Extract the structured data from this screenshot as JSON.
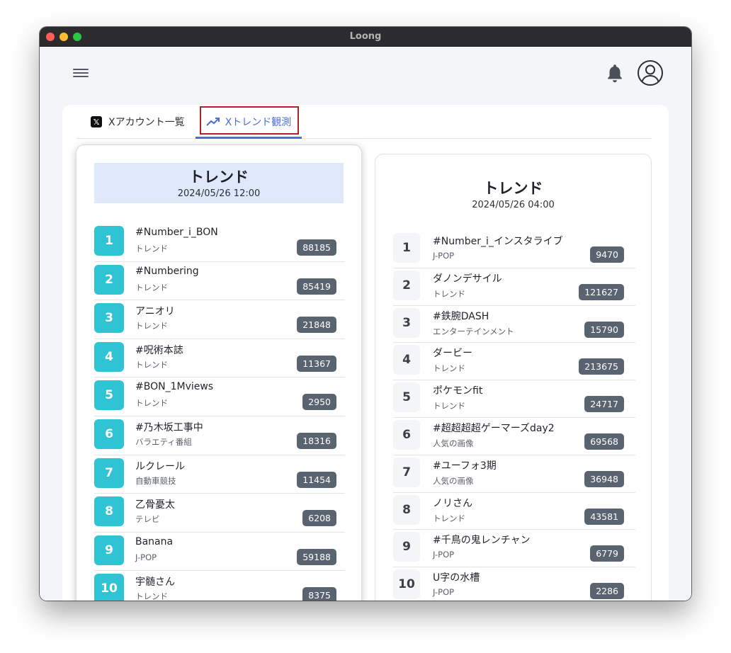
{
  "window": {
    "title": "Loong"
  },
  "tabs": [
    {
      "label": "Xアカウント一覧"
    },
    {
      "label": "Xトレンド観測"
    }
  ],
  "left": {
    "title": "トレンド",
    "datetime": "2024/05/26 12:00",
    "items": [
      {
        "rank": "1",
        "name": "#Number_i_BON",
        "category": "トレンド",
        "count": "88185"
      },
      {
        "rank": "2",
        "name": "#Numbering",
        "category": "トレンド",
        "count": "85419"
      },
      {
        "rank": "3",
        "name": "アニオリ",
        "category": "トレンド",
        "count": "21848"
      },
      {
        "rank": "4",
        "name": "#呪術本誌",
        "category": "トレンド",
        "count": "11367"
      },
      {
        "rank": "5",
        "name": "#BON_1Mviews",
        "category": "トレンド",
        "count": "2950"
      },
      {
        "rank": "6",
        "name": "#乃木坂工事中",
        "category": "バラエティ番組",
        "count": "18316"
      },
      {
        "rank": "7",
        "name": "ルクレール",
        "category": "自動車競技",
        "count": "11454"
      },
      {
        "rank": "8",
        "name": "乙骨憂太",
        "category": "テレビ",
        "count": "6208"
      },
      {
        "rank": "9",
        "name": "Banana",
        "category": "J-POP",
        "count": "59188"
      },
      {
        "rank": "10",
        "name": "宇髄さん",
        "category": "トレンド",
        "count": "8375"
      }
    ]
  },
  "right": {
    "title": "トレンド",
    "datetime": "2024/05/26 04:00",
    "items": [
      {
        "rank": "1",
        "name": "#Number_i_インスタライブ",
        "category": "J-POP",
        "count": "9470"
      },
      {
        "rank": "2",
        "name": "ダノンデサイル",
        "category": "トレンド",
        "count": "121627"
      },
      {
        "rank": "3",
        "name": "#鉄腕DASH",
        "category": "エンターテインメント",
        "count": "15790"
      },
      {
        "rank": "4",
        "name": "ダービー",
        "category": "トレンド",
        "count": "213675"
      },
      {
        "rank": "5",
        "name": "ポケモンfit",
        "category": "トレンド",
        "count": "24717"
      },
      {
        "rank": "6",
        "name": "#超超超超ゲーマーズday2",
        "category": "人気の画像",
        "count": "69568"
      },
      {
        "rank": "7",
        "name": "#ユーフォ3期",
        "category": "人気の画像",
        "count": "36948"
      },
      {
        "rank": "8",
        "name": "ノリさん",
        "category": "トレンド",
        "count": "43581"
      },
      {
        "rank": "9",
        "name": "#千鳥の鬼レンチャン",
        "category": "J-POP",
        "count": "6779"
      },
      {
        "rank": "10",
        "name": "U字の水槽",
        "category": "J-POP",
        "count": "2286"
      }
    ]
  },
  "icons": {
    "menu": "hamburger-icon",
    "bell": "bell-icon",
    "avatar": "user-avatar-icon",
    "x_logo": "x-logo-icon",
    "trend": "trending-up-icon"
  },
  "colors": {
    "accent": "#4a6fd6",
    "rank_badge": "#2ec4d3",
    "count_badge": "#5a6470",
    "header_bg": "#dfe9fb",
    "highlight_box": "#b32024"
  }
}
